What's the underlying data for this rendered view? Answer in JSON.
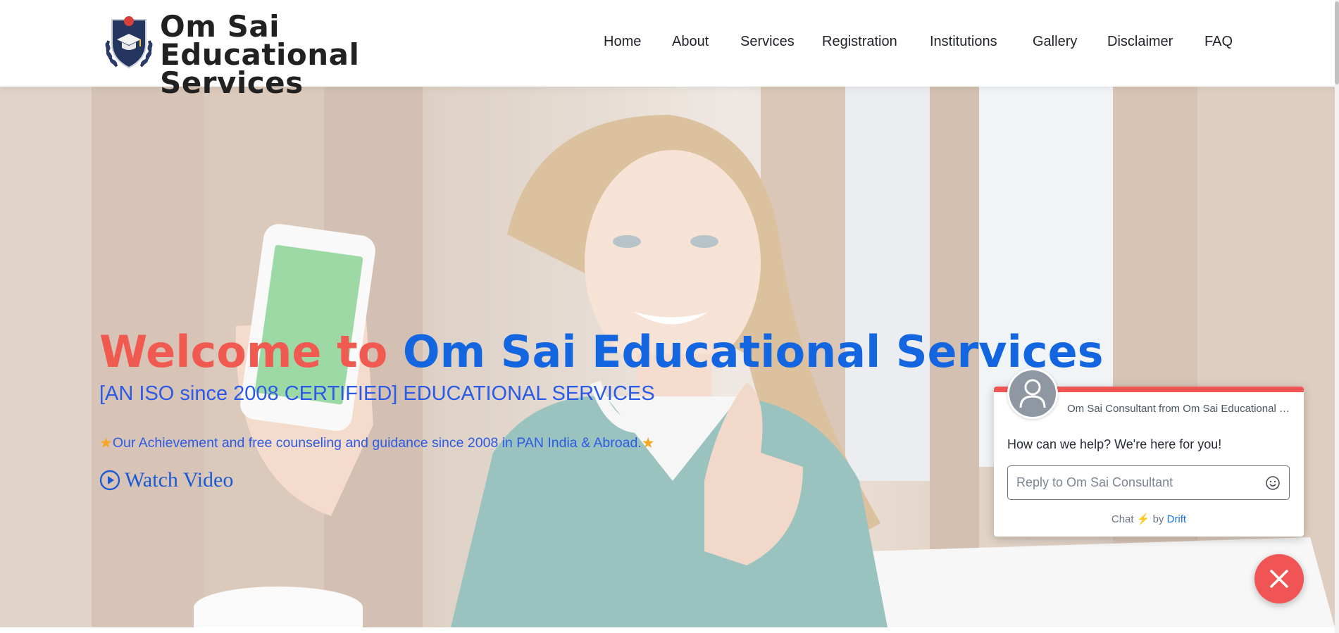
{
  "header": {
    "brand_line1": "Om Sai Educational",
    "brand_line2": "Services",
    "logo_icon": "graduation-cap-shield-icon",
    "nav": [
      {
        "label": "Home"
      },
      {
        "label": "About"
      },
      {
        "label": "Services"
      },
      {
        "label": "Registration"
      },
      {
        "label": "Institutions"
      },
      {
        "label": "Gallery"
      },
      {
        "label": "Disclaimer"
      },
      {
        "label": "FAQ"
      }
    ]
  },
  "hero": {
    "title_part1": "Welcome to ",
    "title_part2": "Om Sai Educational Services",
    "subtitle": "[AN ISO since 2008 CERTIFIED] EDUCATIONAL SERVICES",
    "achievement": "Our Achievement and free counseling and guidance since 2008 in PAN India & Abroad.",
    "watch_label": "Watch Video",
    "colors": {
      "title_red": "#f15a50",
      "title_blue": "#1466e0",
      "sub_blue": "#2a5ae6"
    }
  },
  "chat": {
    "from": "Om Sai Consultant from Om Sai Educational Services",
    "message": "How can we help? We're here for you!",
    "input_placeholder": "Reply to Om Sai Consultant",
    "footer_prefix": "Chat",
    "footer_by": "by",
    "footer_brand": "Drift",
    "accent": "#f05454"
  }
}
